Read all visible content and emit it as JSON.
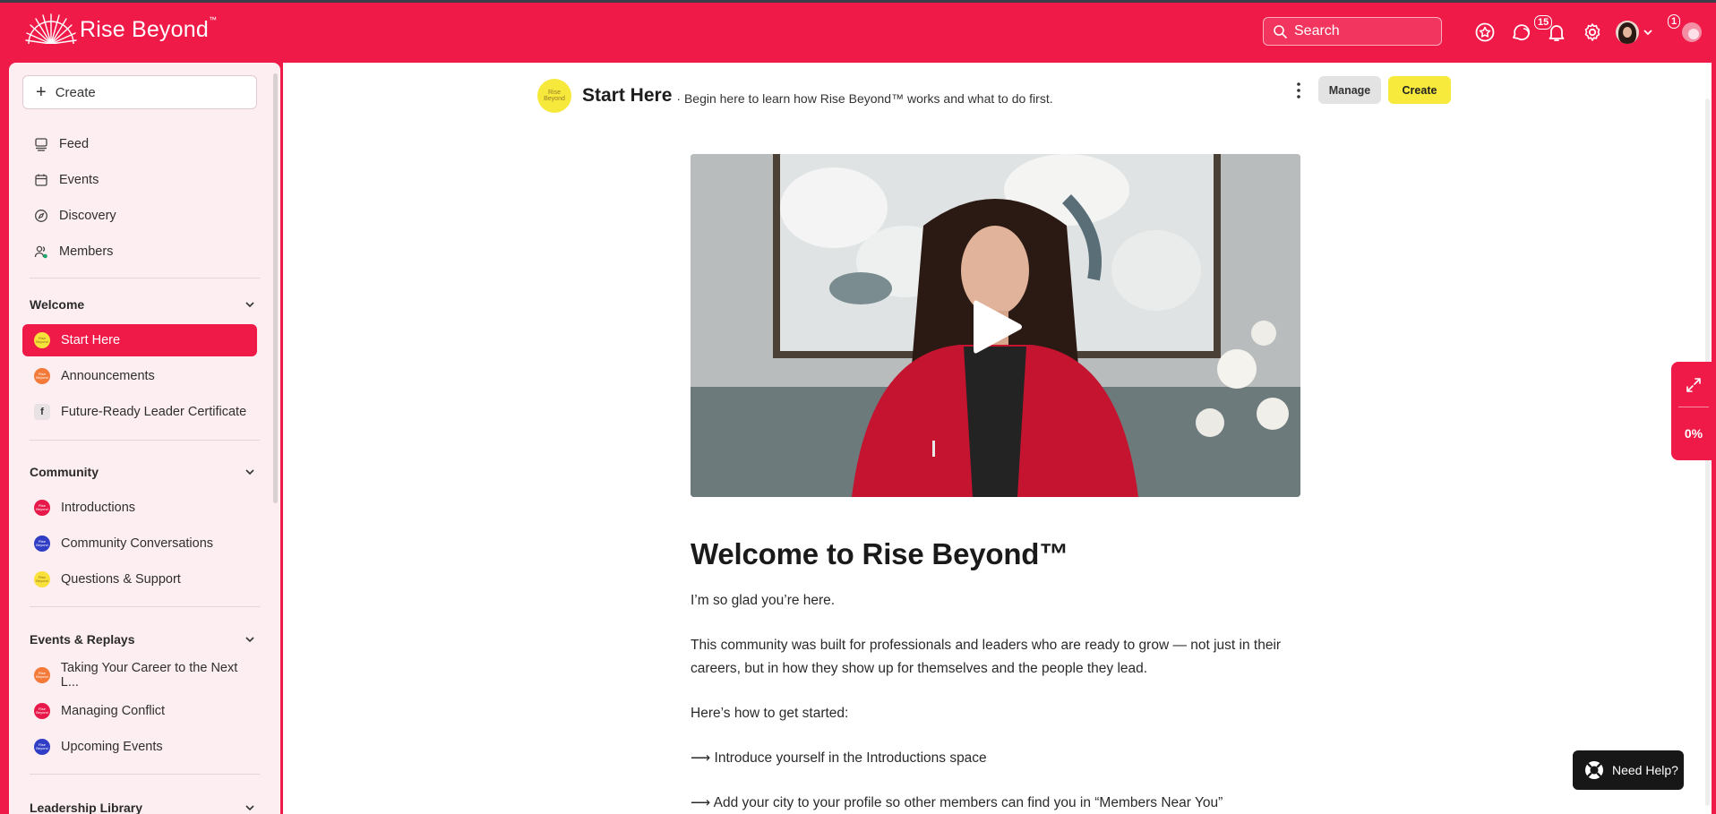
{
  "header": {
    "logo_text": "Rise Beyond",
    "logo_tm": "™",
    "search_placeholder": "Search",
    "chat_badge": "15",
    "profile_badge": "1",
    "icons": [
      "star-circle-icon",
      "chat-bubbles-icon",
      "bell-icon",
      "gear-icon",
      "avatar",
      "chevron-down-icon",
      "extension-icon"
    ]
  },
  "sidebar": {
    "create_label": "Create",
    "main_nav": [
      {
        "label": "Feed",
        "icon": "feed-icon"
      },
      {
        "label": "Events",
        "icon": "calendar-icon"
      },
      {
        "label": "Discovery",
        "icon": "compass-icon"
      },
      {
        "label": "Members",
        "icon": "members-icon"
      }
    ],
    "sections": [
      {
        "title": "Welcome",
        "items": [
          {
            "label": "Start Here",
            "icon_color": "#f8e13b",
            "active": true
          },
          {
            "label": "Announcements",
            "icon_color": "#f47a3a"
          },
          {
            "label": "Future-Ready Leader Certificate",
            "icon_type": "f-letter",
            "icon_letter": "f"
          }
        ]
      },
      {
        "title": "Community",
        "items": [
          {
            "label": "Introductions",
            "icon_color": "#e8194a"
          },
          {
            "label": "Community Conversations",
            "icon_color": "#2f3ec4"
          },
          {
            "label": "Questions & Support",
            "icon_color": "#f8e13b"
          }
        ]
      },
      {
        "title": "Events & Replays",
        "items": [
          {
            "label": "Taking Your Career to the Next L...",
            "icon_color": "#f47a3a"
          },
          {
            "label": "Managing Conflict",
            "icon_color": "#e8194a"
          },
          {
            "label": "Upcoming Events",
            "icon_color": "#2f3ec4"
          }
        ]
      },
      {
        "title": "Leadership Library",
        "items": []
      }
    ],
    "space_icon_text": "Rise Beyond"
  },
  "main": {
    "space_logo_text": "Rise Beyond",
    "space_title": "Start Here",
    "space_desc": "· Begin here to learn how Rise Beyond™ works and what to do first.",
    "manage_label": "Manage",
    "create_label": "Create",
    "article": {
      "heading": "Welcome to Rise Beyond™",
      "paragraphs": [
        "I’m so glad you’re here.",
        "This community was built for professionals and leaders who are ready to grow — not just in their careers, but in how they show up for themselves and the people they lead.",
        "Here’s how to get started:",
        "⟶ Introduce yourself in the Introductions space",
        "⟶ Add your city to your profile so other members can find you in “Members Near You”"
      ]
    }
  },
  "progress": {
    "percent_label": "0%",
    "percent": 0
  },
  "help": {
    "label": "Need Help?"
  },
  "colors": {
    "brand": "#ef1a48",
    "accent_yellow": "#f8ea3c",
    "sidebar_bg": "#fdeef1"
  }
}
